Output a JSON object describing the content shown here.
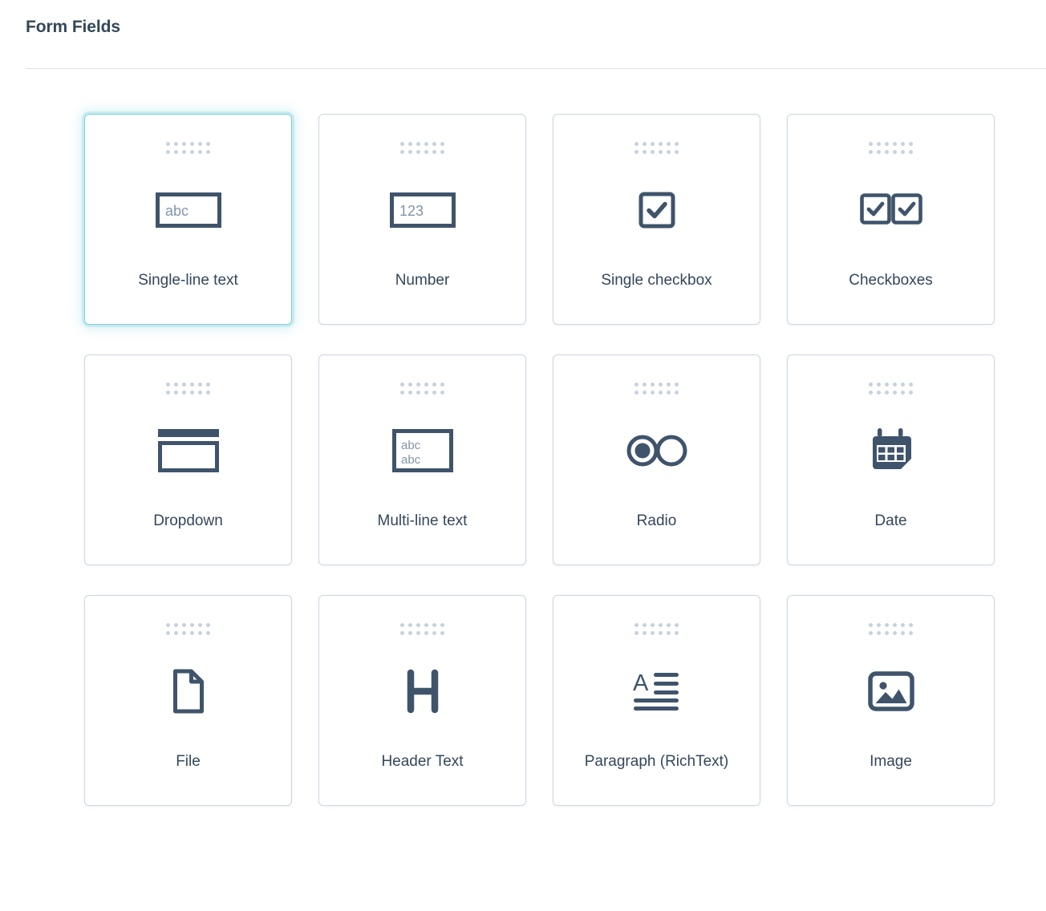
{
  "header": {
    "title": "Form Fields"
  },
  "colors": {
    "title_text": "#33475b",
    "label_text": "#33475b",
    "card_border": "#cbd6e2",
    "card_border_selected": "#7fd1de",
    "divider": "#dfe3eb",
    "drag_dot": "#c7d2e0",
    "icon_stroke": "#3f546b",
    "icon_placeholder_text": "#7c98b6",
    "background": "#ffffff"
  },
  "grid": {
    "columns": 4,
    "rows": 3,
    "drag_handle_icon": "drag-handle-dots-icon",
    "drag_handle_dots": 12,
    "cards": [
      {
        "id": "single-line-text",
        "label": "Single-line text",
        "icon": "text-input-abc-icon",
        "icon_text": "abc",
        "selected": true
      },
      {
        "id": "number",
        "label": "Number",
        "icon": "number-input-123-icon",
        "icon_text": "123",
        "selected": false
      },
      {
        "id": "single-checkbox",
        "label": "Single checkbox",
        "icon": "checkbox-checked-icon",
        "icon_text": "",
        "selected": false
      },
      {
        "id": "checkboxes",
        "label": "Checkboxes",
        "icon": "multiple-checkboxes-checked-icon",
        "icon_text": "",
        "selected": false
      },
      {
        "id": "dropdown",
        "label": "Dropdown",
        "icon": "dropdown-select-icon",
        "icon_text": "",
        "selected": false
      },
      {
        "id": "multi-line-text",
        "label": "Multi-line text",
        "icon": "textarea-abc-abc-icon",
        "icon_text": "abc abc",
        "selected": false
      },
      {
        "id": "radio",
        "label": "Radio",
        "icon": "radio-buttons-icon",
        "icon_text": "",
        "selected": false
      },
      {
        "id": "date",
        "label": "Date",
        "icon": "calendar-icon",
        "icon_text": "",
        "selected": false
      },
      {
        "id": "file",
        "label": "File",
        "icon": "file-document-icon",
        "icon_text": "",
        "selected": false
      },
      {
        "id": "header-text",
        "label": "Header Text",
        "icon": "heading-h-icon",
        "icon_text": "H",
        "selected": false
      },
      {
        "id": "paragraph-richtext",
        "label": "Paragraph (RichText)",
        "icon": "rich-text-paragraph-icon",
        "icon_text": "",
        "selected": false
      },
      {
        "id": "image",
        "label": "Image",
        "icon": "image-picture-icon",
        "icon_text": "",
        "selected": false
      }
    ]
  }
}
